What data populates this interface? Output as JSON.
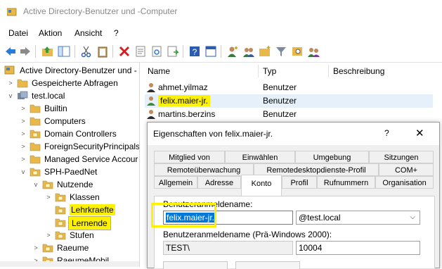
{
  "window": {
    "title": "Active Directory-Benutzer und -Computer"
  },
  "menu": [
    "Datei",
    "Aktion",
    "Ansicht",
    "?"
  ],
  "toolbar": {
    "icons": [
      "back-arrow-icon",
      "forward-arrow-icon",
      "up-folder-icon",
      "show-tree-icon",
      "cut-icon",
      "clipboard-icon",
      "delete-icon",
      "properties-icon",
      "refresh-icon",
      "export-list-icon",
      "help-icon",
      "console-icon",
      "new-user-icon",
      "new-group-icon",
      "new-ou-icon",
      "filter-icon",
      "find-icon",
      "add-to-group-icon"
    ]
  },
  "tree": {
    "items": [
      {
        "label": "Active Directory-Benutzer und -",
        "icon": "ad-snapin-icon",
        "chevron": ""
      },
      {
        "label": "Gespeicherte Abfragen",
        "icon": "folder-icon",
        "chevron": ">"
      },
      {
        "label": "test.local",
        "icon": "domain-icon",
        "chevron": "v"
      },
      {
        "label": "Builtin",
        "icon": "folder-icon",
        "chevron": ">"
      },
      {
        "label": "Computers",
        "icon": "folder-icon",
        "chevron": ">"
      },
      {
        "label": "Domain Controllers",
        "icon": "ou-icon",
        "chevron": ">"
      },
      {
        "label": "ForeignSecurityPrincipals",
        "icon": "folder-icon",
        "chevron": ">"
      },
      {
        "label": "Managed Service Accour",
        "icon": "folder-icon",
        "chevron": ">"
      },
      {
        "label": "SPH-PaedNet",
        "icon": "ou-icon",
        "chevron": "v"
      },
      {
        "label": "Nutzende",
        "icon": "ou-icon",
        "chevron": "v"
      },
      {
        "label": "Klassen",
        "icon": "ou-icon",
        "chevron": ">"
      },
      {
        "label": "Lehrkraefte",
        "icon": "ou-icon",
        "chevron": ""
      },
      {
        "label": "Lernende",
        "icon": "ou-icon",
        "chevron": ""
      },
      {
        "label": "Stufen",
        "icon": "ou-icon",
        "chevron": ">"
      },
      {
        "label": "Raeume",
        "icon": "ou-icon",
        "chevron": ">"
      },
      {
        "label": "RaeumeMobil",
        "icon": "ou-icon",
        "chevron": ">"
      }
    ]
  },
  "list": {
    "columns": [
      "Name",
      "Typ",
      "Beschreibung"
    ],
    "rows": [
      {
        "name": "ahmet.yilmaz",
        "typ": "Benutzer"
      },
      {
        "name": "felix.maier-jr.",
        "typ": "Benutzer"
      },
      {
        "name": "martins.berzins",
        "typ": "Benutzer"
      }
    ]
  },
  "dialog": {
    "title": "Eigenschaften von felix.maier-jr.",
    "help": "?",
    "close": "✕",
    "tabs_row1": [
      "Mitglied von",
      "Einwählen",
      "Umgebung",
      "Sitzungen"
    ],
    "tabs_row2": [
      "Remoteüberwachung",
      "Remotedesktopdienste-Profil",
      "COM+"
    ],
    "tabs_row3": [
      "Allgemein",
      "Adresse",
      "Konto",
      "Profil",
      "Rufnummern",
      "Organisation"
    ],
    "active_tab": "Konto",
    "logon_label": "Benutzeranmeldename:",
    "logon_value": "felix.maier-jr.",
    "domain_suffix": "@test.local",
    "pre2000_label": "Benutzeranmeldename (Prä-Windows 2000):",
    "pre2000_domain": "TEST\\",
    "pre2000_value": "10004"
  },
  "colors": {
    "highlight": "#fff200",
    "selection": "#0078d7",
    "folder": "#e8b84a"
  }
}
